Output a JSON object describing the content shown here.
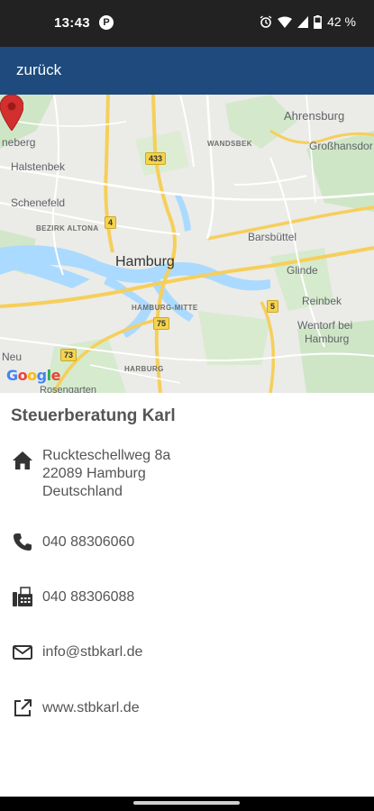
{
  "status_bar": {
    "time": "13:43",
    "app_icon_glyph": "P",
    "battery": "42 %"
  },
  "app_bar": {
    "back_label": "zurück"
  },
  "map": {
    "labels": {
      "ahrensburg": "Ahrensburg",
      "eneberg": "neberg",
      "wandsbek": "WANDSBEK",
      "grosshansdorf": "Großhansdor",
      "halstenbek": "Halstenbek",
      "schenefeld": "Schenefeld",
      "bezirk_altona": "BEZIRK ALTONA",
      "hamburg": "Hamburg",
      "barsbuettel": "Barsbüttel",
      "glinde": "Glinde",
      "reinbek": "Reinbek",
      "hamburg_mitte": "HAMBURG-MITTE",
      "wentorf_line1": "Wentorf bei",
      "wentorf_line2": "Hamburg",
      "neu": "Neu",
      "harburg": "HARBURG",
      "rosengarten": "Rosengarten"
    },
    "road_badges": {
      "r433": "433",
      "r4": "4",
      "r5": "5",
      "r75": "75",
      "r73": "73"
    },
    "logo": "Google"
  },
  "business": {
    "name": "Steuerberatung Karl",
    "address_line1": "Ruckteschellweg 8a",
    "address_line2": "22089 Hamburg",
    "address_line3": "Deutschland",
    "phone": "040 88306060",
    "fax": "040 88306088",
    "email": "info@stbkarl.de",
    "website": "www.stbkarl.de"
  },
  "icons": {
    "address": "home-icon",
    "phone": "phone-icon",
    "fax": "fax-icon",
    "email": "email-icon",
    "website": "external-link-icon"
  },
  "colors": {
    "app_bar": "#1e4a7d",
    "status_bar": "#222222",
    "pin": "#d32f2f",
    "text": "#555555"
  }
}
